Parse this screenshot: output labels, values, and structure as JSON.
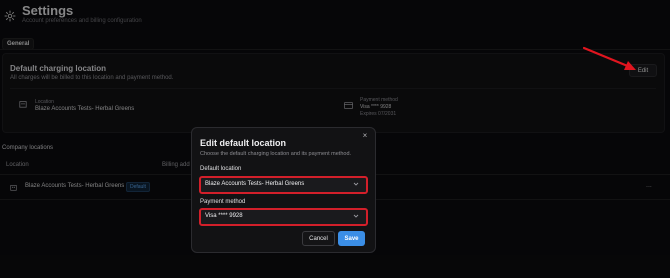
{
  "header": {
    "title": "Settings",
    "subtitle": "Account preferences and billing configuration"
  },
  "tabs": {
    "general": "General"
  },
  "charging": {
    "title": "Default charging location",
    "description": "All charges will be billed to this location and payment method.",
    "edit_label": "Edit",
    "location_label": "Location",
    "location_value": "Blaze Accounts Tests- Herbal Greens",
    "payment_label": "Payment method",
    "payment_value": "Visa **** 9928",
    "payment_expiry": "Expires 07/2031"
  },
  "company_locations": {
    "title": "Company locations",
    "columns": [
      "Location",
      "Billing add"
    ],
    "rows": [
      {
        "name": "Blaze Accounts Tests- Herbal Greens",
        "badge": "Default",
        "more": "..."
      }
    ]
  },
  "modal": {
    "close": "×",
    "title": "Edit default location",
    "description": "Choose the default charging location and its payment method.",
    "location_label": "Default location",
    "location_value": "Blaze Accounts Tests- Herbal Greens",
    "payment_label": "Payment method",
    "payment_value": "Visa **** 9928",
    "cancel_label": "Cancel",
    "save_label": "Save"
  },
  "colors": {
    "accent": "#3b8ee6",
    "highlight": "#d21f2a",
    "background": "#0b0b0d"
  },
  "icons": {
    "header": "gear-icon",
    "location": "building-icon",
    "payment": "credit-card-icon",
    "chevron": "chevron-down-icon",
    "close": "close-icon"
  }
}
